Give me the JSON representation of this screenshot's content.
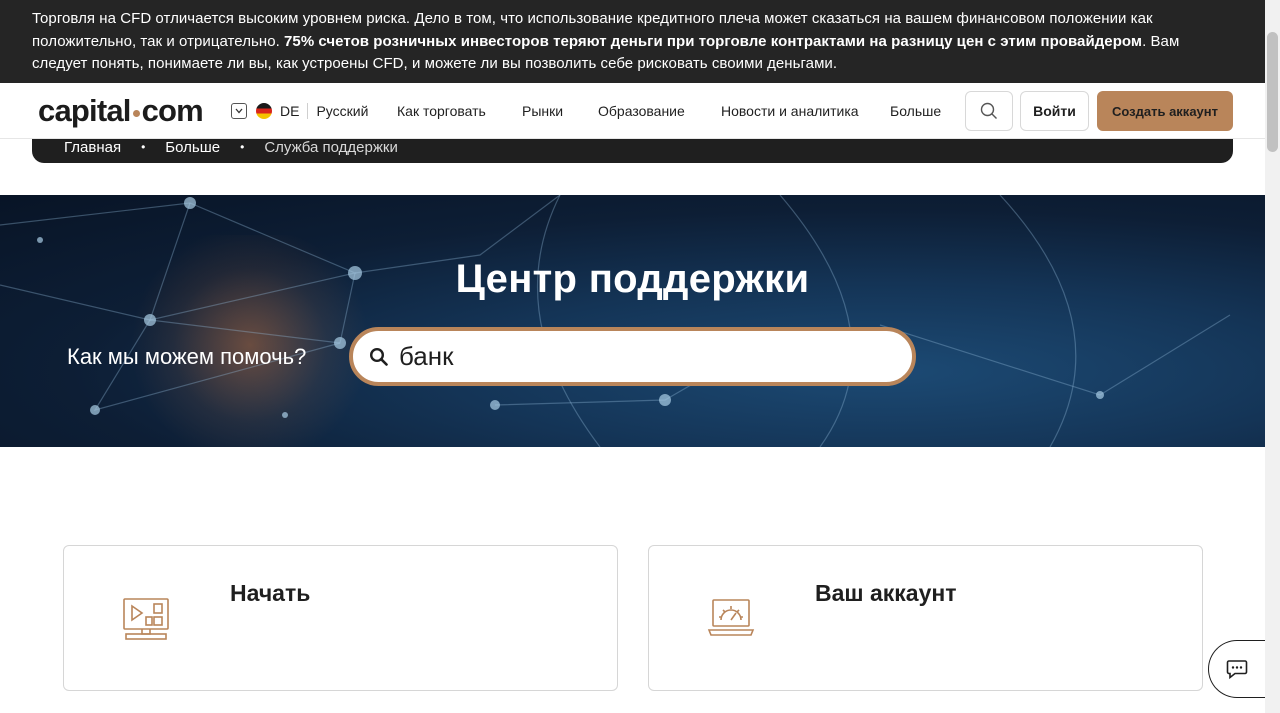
{
  "risk_banner": {
    "text_before": "Торговля на CFD отличается высоким уровнем риска. Дело в том, что использование кредитного плеча может сказаться на вашем финансовом положении как положительно, так и отрицательно. ",
    "text_bold": "75% счетов розничных инвесторов теряют деньги при торговле контрактами на разницу цен с этим провайдером",
    "text_after": ". Вам следует понять, понимаете ли вы, как устроены CFD, и можете ли вы позволить себе рисковать своими деньгами."
  },
  "header": {
    "logo_left": "capital",
    "logo_right": "com",
    "region_code": "DE",
    "language": "Русский",
    "nav": [
      "Как торговать",
      "Рынки",
      "Образование",
      "Новости и аналитика",
      "Больше"
    ],
    "login_label": "Войти",
    "signup_label": "Создать аккаунт"
  },
  "breadcrumb": {
    "items": [
      "Главная",
      "Больше",
      "Служба поддержки"
    ],
    "separator": "•"
  },
  "hero": {
    "title": "Центр поддержки",
    "help_label": "Как мы можем помочь?",
    "search_value": "банк"
  },
  "cards": [
    {
      "title": "Начать",
      "icon": "video-tutorial-icon"
    },
    {
      "title": "Ваш аккаунт",
      "icon": "account-settings-laptop-icon"
    }
  ],
  "colors": {
    "accent": "#b9855a",
    "banner_bg": "#252525",
    "hero_bg": "#0d1e35"
  }
}
